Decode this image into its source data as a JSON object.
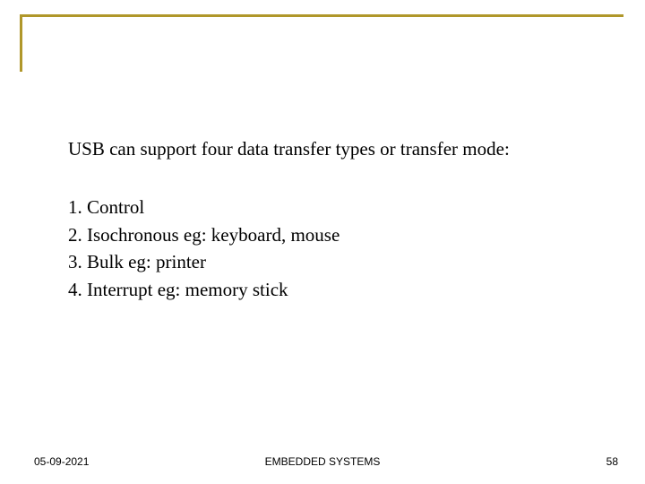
{
  "content": {
    "intro": "USB can support four data transfer types or transfer mode:",
    "items": [
      "1. Control",
      "2. Isochronous eg: keyboard, mouse",
      "3. Bulk eg: printer",
      "4. Interrupt eg: memory stick"
    ]
  },
  "footer": {
    "date": "05-09-2021",
    "title": "EMBEDDED SYSTEMS",
    "page": "58"
  }
}
